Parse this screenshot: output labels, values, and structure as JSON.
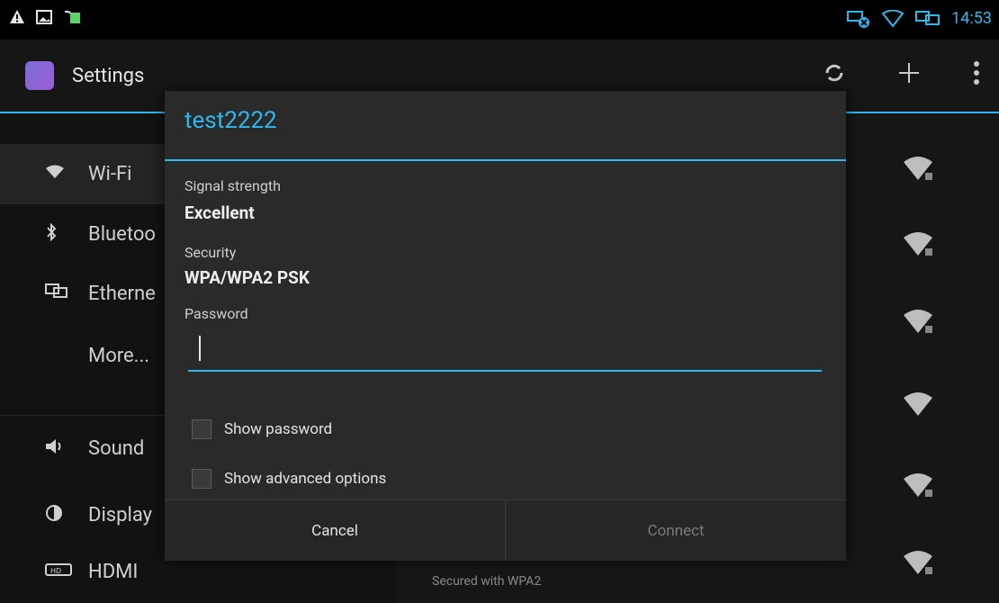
{
  "status_bar": {
    "time": "14:53",
    "left_icons": [
      "warning-icon",
      "image-icon",
      "battery-charge-icon"
    ],
    "right_icons": [
      "network-x-icon",
      "wifi-outline-icon",
      "screens-icon"
    ]
  },
  "action_bar": {
    "title": "Settings"
  },
  "left_menu": [
    {
      "label": "Wi-Fi",
      "icon": "wifi-icon"
    },
    {
      "label": "Bluetoo",
      "icon": "bluetooth-icon"
    },
    {
      "label": "Etherne",
      "icon": "ethernet-icon"
    },
    {
      "label": "More...",
      "icon": ""
    },
    {
      "label": "Sound",
      "icon": "sound-icon"
    },
    {
      "label": "Display",
      "icon": "display-icon"
    },
    {
      "label": "HDMI",
      "icon": "hdmi-icon"
    }
  ],
  "right_pane": {
    "secured_text": "Secured with WPA2"
  },
  "dialog": {
    "title": "test2222",
    "signal_label": "Signal strength",
    "signal_value": "Excellent",
    "security_label": "Security",
    "security_value": "WPA/WPA2 PSK",
    "password_label": "Password",
    "password_value": "",
    "show_password_label": "Show password",
    "show_advanced_label": "Show advanced options",
    "cancel_label": "Cancel",
    "connect_label": "Connect"
  },
  "colors": {
    "accent": "#2fb8f0",
    "dialog_bg": "#2a2a2a"
  }
}
